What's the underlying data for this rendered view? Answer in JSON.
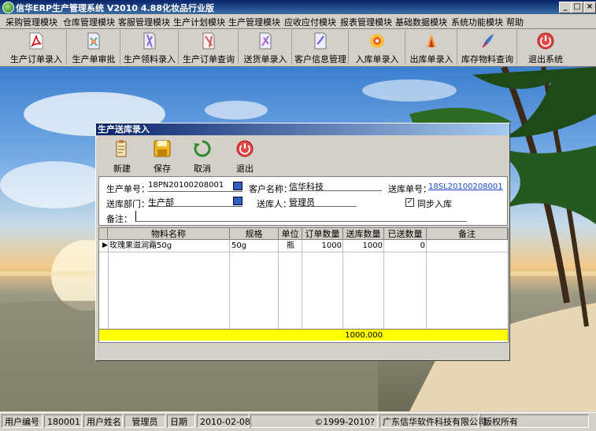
{
  "window": {
    "title": "信华ERP生产管理系统  V2010 4.88化妆品行业版",
    "controls": {
      "minimize": "_",
      "restore": "□",
      "close": "×"
    }
  },
  "menu": [
    "采购管理模块",
    "仓库管理模块",
    "客服管理模块",
    "生产计划模块",
    "生产管理模块",
    "应收应付模块",
    "报表管理模块",
    "基础数据模块",
    "系统功能模块",
    "帮助"
  ],
  "toolbar": [
    {
      "label": "生产订单录入",
      "icon": "pdf-icon"
    },
    {
      "label": "生产单审批",
      "icon": "approve-doc-icon"
    },
    {
      "label": "生产领料录入",
      "icon": "material-doc-icon"
    },
    {
      "label": "生产订单查询",
      "icon": "query-doc-icon"
    },
    {
      "label": "送货单录入",
      "icon": "delivery-doc-icon"
    },
    {
      "label": "客户信息管理",
      "icon": "customer-doc-icon"
    },
    {
      "label": "入库单录入",
      "icon": "stock-in-icon"
    },
    {
      "label": "出库单录入",
      "icon": "stock-out-icon"
    },
    {
      "label": "库存物料查询",
      "icon": "inventory-icon"
    },
    {
      "label": "退出系统",
      "icon": "exit-icon"
    }
  ],
  "dialog": {
    "title": "生产送库录入",
    "buttons": [
      {
        "label": "新建",
        "icon": "new-icon"
      },
      {
        "label": "保存",
        "icon": "save-icon"
      },
      {
        "label": "取消",
        "icon": "cancel-icon"
      },
      {
        "label": "退出",
        "icon": "exit-icon"
      }
    ],
    "form": {
      "order_no_label": "生产单号：",
      "order_no": "18PN20100208001",
      "customer_label": "客户名称：",
      "customer": "信华科技",
      "delivery_no_label": "送库单号：",
      "delivery_no": "18SL20100208001",
      "dept_label": "送库部门：",
      "dept": "生产部",
      "sender_label": "送库人：",
      "sender": "管理员",
      "sync_label": "同步入库",
      "sync_checked": true,
      "remark_label": "备注：",
      "remark": ""
    },
    "grid": {
      "columns": [
        "物料名称",
        "规格",
        "单位",
        "订单数量",
        "送库数量",
        "已送数量",
        "备注"
      ],
      "rows": [
        {
          "name": "玫瑰果滋润霜50g",
          "spec": "50g",
          "unit": "瓶",
          "order_qty": "1000",
          "send_qty": "1000",
          "sent_qty": "0",
          "remark": ""
        }
      ],
      "total_send_qty": "1000.000"
    }
  },
  "status": {
    "user_no_label": "用户编号",
    "user_no": "180001",
    "user_name_label": "用户姓名",
    "user_name": "管理员",
    "date_label": "日期",
    "date": "2010-02-08",
    "copyright": "©1999-2010?",
    "company": "广东信华软件科技有限公司",
    "rights": "版权所有"
  }
}
